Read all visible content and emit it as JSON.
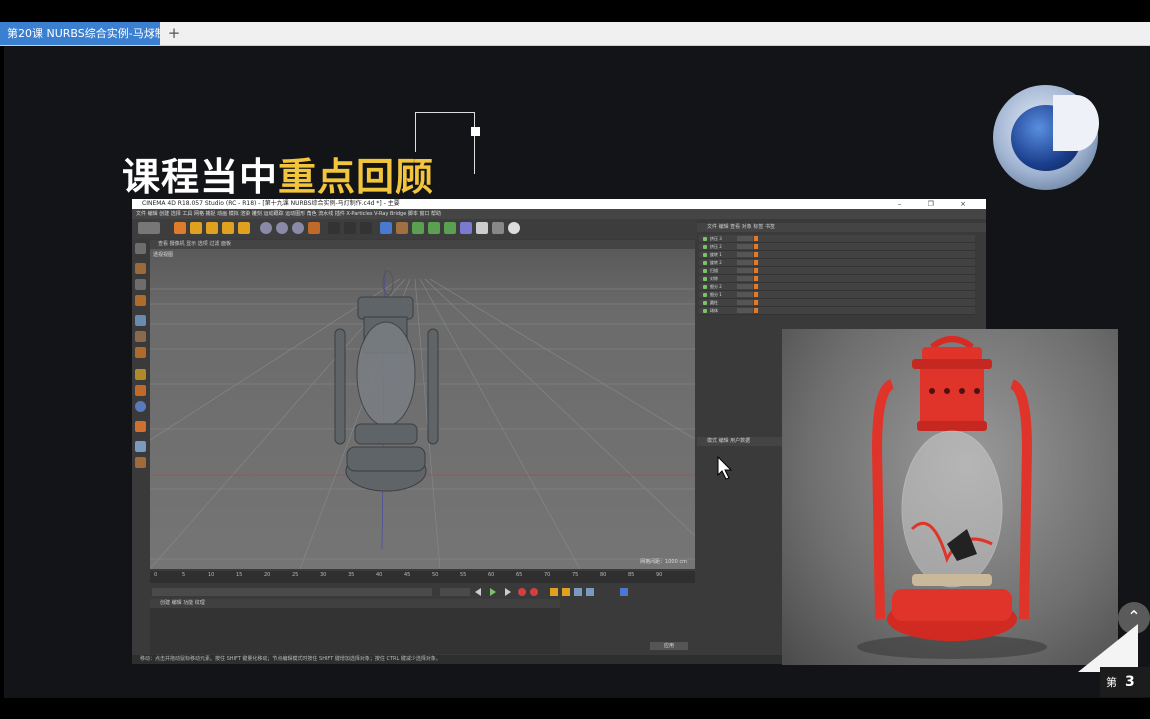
{
  "browser": {
    "tab_label": "第20课 NURBS综合实例-马灯制",
    "tab_close": "×",
    "tab_add": "+"
  },
  "slide": {
    "title_white": "课程当中",
    "title_highlight": "重点回顾",
    "page_label": "第",
    "page_number": "3",
    "scroll_up": "⌃"
  },
  "c4d": {
    "title": "CINEMA 4D R18.057 Studio (RC - R18) - [第十九课 NURBS综合实例-马灯制作.c4d *] - 主要",
    "window_buttons": "– ❐ ×",
    "menu": "文件  编辑  创建  选择  工具  网格  捕捉  动画  模拟  渲染  雕刻  运动跟踪  运动图形  角色  流水线  插件  X-Particles  V-Ray Bridge  脚本  窗口  帮助",
    "viewport_menu": "查看  摄像机  显示  选项  过滤  面板",
    "viewport_label": "透视视图",
    "viewport_scale": "网格间距：1000 cm",
    "timeline_numbers": [
      "0",
      "5",
      "10",
      "15",
      "20",
      "25",
      "30",
      "35",
      "40",
      "45",
      "50",
      "55",
      "60",
      "65",
      "70",
      "75",
      "80",
      "85",
      "90"
    ],
    "material_menu": "创建  编辑  功能  纹理",
    "coord_button": "应用",
    "status": "移动：点击并拖动鼠标移动元素。按住 SHIFT 键量化移动；节点编辑模式时按住 SHIFT 键增加选择对象；按住 CTRL 键减少选择对象。",
    "object_menu": "文件  编辑  查看  对象  标签  书签",
    "attr_menu": "模式  编辑  用户数据",
    "objects": [
      "挤压 3",
      "挤压 2",
      "旋转 1",
      "旋转 2",
      "扫描",
      "对称",
      "细分 2",
      "细分 1",
      "圆柱",
      "球体"
    ]
  }
}
